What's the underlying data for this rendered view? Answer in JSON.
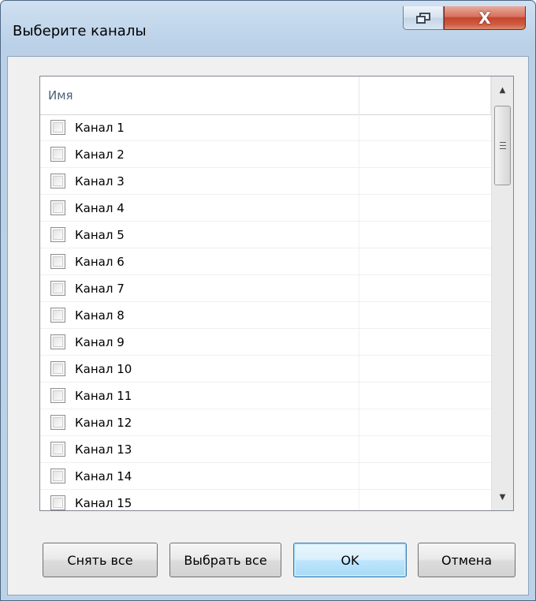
{
  "window": {
    "title": "Выберите каналы",
    "close_glyph": "X",
    "restore_icon": "restore-window-icon"
  },
  "list": {
    "columns": [
      "Имя",
      ""
    ],
    "rows": [
      {
        "label": "Канал 1",
        "checked": false
      },
      {
        "label": "Канал 2",
        "checked": false
      },
      {
        "label": "Канал 3",
        "checked": false
      },
      {
        "label": "Канал 4",
        "checked": false
      },
      {
        "label": "Канал 5",
        "checked": false
      },
      {
        "label": "Канал 6",
        "checked": false
      },
      {
        "label": "Канал 7",
        "checked": false
      },
      {
        "label": "Канал 8",
        "checked": false
      },
      {
        "label": "Канал 9",
        "checked": false
      },
      {
        "label": "Канал 10",
        "checked": false
      },
      {
        "label": "Канал 11",
        "checked": false
      },
      {
        "label": "Канал 12",
        "checked": false
      },
      {
        "label": "Канал 13",
        "checked": false
      },
      {
        "label": "Канал 14",
        "checked": false
      },
      {
        "label": "Канал 15",
        "checked": false
      }
    ],
    "scroll": {
      "up_glyph": "▲",
      "down_glyph": "▼"
    }
  },
  "buttons": {
    "clear_all": "Снять все",
    "select_all": "Выбрать все",
    "ok": "OK",
    "cancel": "Отмена"
  },
  "colors": {
    "title_bar": "#bcd2e8",
    "close_button": "#c5462e",
    "default_button_border": "#3c7fb1"
  }
}
